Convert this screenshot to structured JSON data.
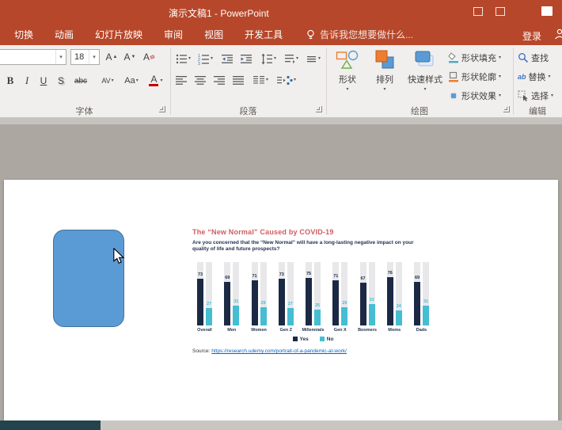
{
  "titlebar": {
    "title": "演示文稿1 - PowerPoint"
  },
  "ribbon": {
    "tabs": [
      {
        "label": "切换"
      },
      {
        "label": "动画"
      },
      {
        "label": "幻灯片放映"
      },
      {
        "label": "审阅"
      },
      {
        "label": "视图"
      },
      {
        "label": "开发工具"
      }
    ],
    "tell_me": "告诉我您想要做什么...",
    "sign_in": "登录",
    "font": {
      "group_label": "字体",
      "size_value": "18",
      "bold": "B",
      "italic": "I",
      "underline": "U",
      "shadow": "S",
      "strikethrough": "abc",
      "spacing": "AV",
      "case": "Aa",
      "color": "A",
      "grow": "A",
      "shrink": "A",
      "clear": "A"
    },
    "paragraph": {
      "group_label": "段落"
    },
    "drawing": {
      "group_label": "绘图",
      "shapes": "形状",
      "arrange": "排列",
      "quick_styles": "快速样式",
      "shape_fill": "形状填充",
      "shape_outline": "形状轮廓",
      "shape_effects": "形状效果"
    },
    "editing": {
      "group_label": "编辑",
      "find": "查找",
      "replace": "替换",
      "select": "选择",
      "replace_icon_text": "ab"
    }
  },
  "slide": {
    "chart": {
      "title": "The “New Normal” Caused by COVID-19",
      "subtitle": "Are you concerned that the “New Normal” will have a long-lasting negative impact on your quality of life and future prospects?",
      "source_prefix": "Source: ",
      "source_link": "https://research.udemy.com/portrait-of-a-pandemic-at-work/"
    }
  },
  "chart_data": {
    "type": "bar",
    "title": "The “New Normal” Caused by COVID-19",
    "categories": [
      "Overall",
      "Men",
      "Women",
      "Gen Z",
      "Millennials",
      "Gen X",
      "Boomers",
      "Moms",
      "Dads"
    ],
    "series": [
      {
        "name": "Yes",
        "color": "#1B2944",
        "values": [
          73,
          69,
          71,
          73,
          75,
          71,
          67,
          76,
          69
        ]
      },
      {
        "name": "No",
        "color": "#45BDD2",
        "values": [
          27,
          31,
          29,
          27,
          25,
          29,
          33,
          24,
          31
        ]
      }
    ],
    "ylim": [
      0,
      100
    ],
    "legend_position": "bottom"
  }
}
